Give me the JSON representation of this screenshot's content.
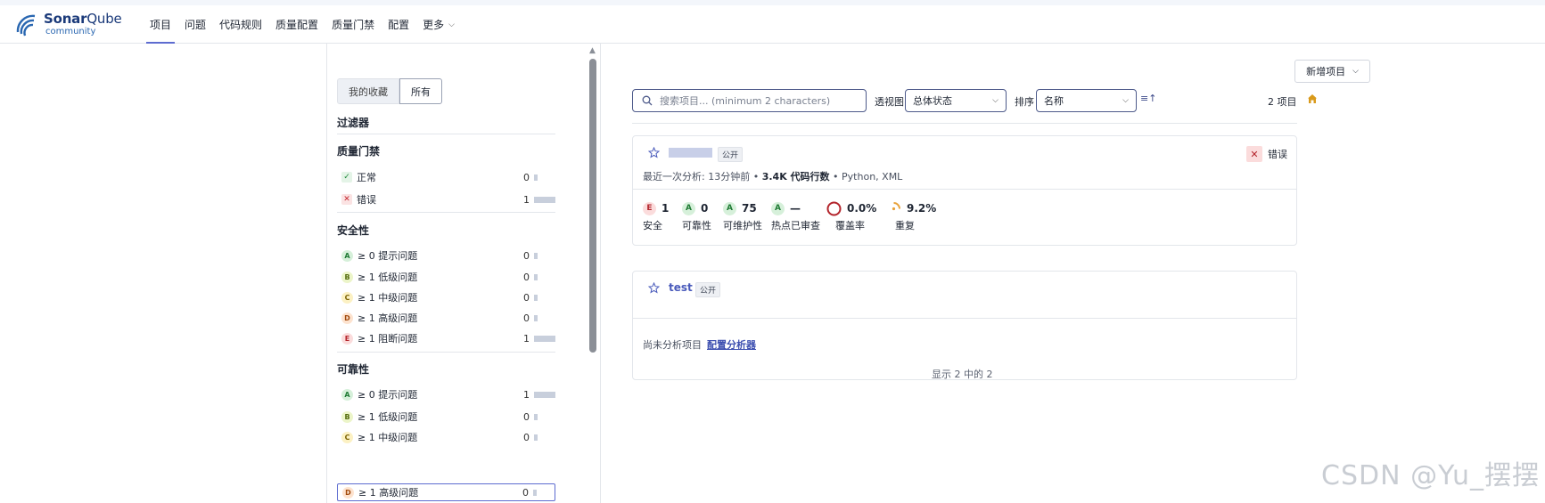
{
  "brand": {
    "name_bold": "Sonar",
    "name_rest": "Qube",
    "edition": "community"
  },
  "nav": {
    "items": [
      "项目",
      "问题",
      "代码规则",
      "质量配置",
      "质量门禁",
      "配置",
      "更多"
    ],
    "active": "项目"
  },
  "sidebar": {
    "toggle": {
      "favorites": "我的收藏",
      "all": "所有"
    },
    "filters_title": "过滤器",
    "quality_gate": {
      "title": "质量门禁",
      "rows": [
        {
          "label": "正常",
          "count": "0"
        },
        {
          "label": "错误",
          "count": "1"
        }
      ]
    },
    "security": {
      "title": "安全性",
      "rows": [
        {
          "grade": "A",
          "label": "≥ 0 提示问题",
          "count": "0"
        },
        {
          "grade": "B",
          "label": "≥ 1 低级问题",
          "count": "0"
        },
        {
          "grade": "C",
          "label": "≥ 1 中级问题",
          "count": "0"
        },
        {
          "grade": "D",
          "label": "≥ 1 高级问题",
          "count": "0"
        },
        {
          "grade": "E",
          "label": "≥ 1 阻断问题",
          "count": "1"
        }
      ]
    },
    "reliability": {
      "title": "可靠性",
      "rows": [
        {
          "grade": "A",
          "label": "≥ 0 提示问题",
          "count": "1"
        },
        {
          "grade": "B",
          "label": "≥ 1 低级问题",
          "count": "0"
        },
        {
          "grade": "C",
          "label": "≥ 1 中级问题",
          "count": "0"
        },
        {
          "grade": "D",
          "label": "≥ 1 高级问题",
          "count": "0"
        }
      ]
    }
  },
  "toolbar": {
    "new_project": "新增项目",
    "search_placeholder": "搜索项目... (minimum 2 characters)",
    "perspective_label": "透视图",
    "perspective_value": "总体状态",
    "sort_label": "排序",
    "sort_value": "名称",
    "count": "2 项目"
  },
  "projects": [
    {
      "visibility": "公开",
      "quality_gate": "错误",
      "last_analysis_label": "最近一次分析:",
      "last_analysis_time": "13分钟前",
      "loc": "3.4K 代码行数",
      "languages": "Python, XML",
      "metrics": [
        {
          "grade": "E",
          "value": "1",
          "name": "安全"
        },
        {
          "grade": "A",
          "value": "0",
          "name": "可靠性"
        },
        {
          "grade": "A",
          "value": "75",
          "name": "可维护性"
        },
        {
          "grade": "A",
          "value": "—",
          "name": "热点已审查"
        },
        {
          "value": "0.0%",
          "name": "覆盖率"
        },
        {
          "value": "9.2%",
          "name": "重复"
        }
      ]
    },
    {
      "name": "test",
      "visibility": "公开",
      "not_analyzed": "尚未分析项目",
      "configure_link": "配置分析器"
    }
  ],
  "footer": {
    "shown": "显示 2 中的 2"
  },
  "watermark": "CSDN @Yu_摆摆",
  "colors": {
    "accent": "#5d6cd0",
    "error": "#b3242b",
    "ok": "#1f8a3a",
    "brand": "#1b3a7a"
  }
}
